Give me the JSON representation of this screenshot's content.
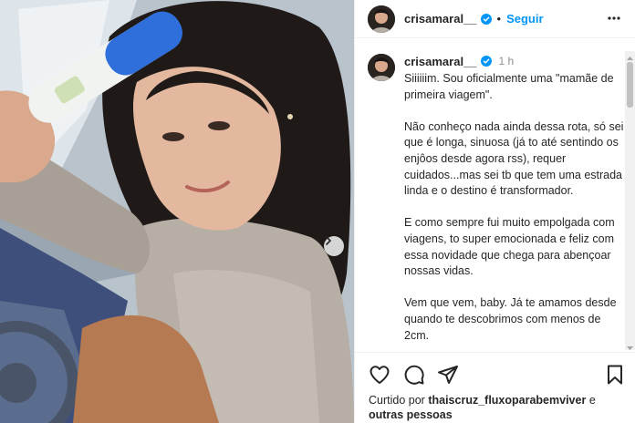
{
  "post": {
    "username": "crisamaral__",
    "follow_label": "Seguir",
    "separator": "•",
    "caption_time": "1 h",
    "caption_text": "Siiiiiim. Sou oficialmente uma \"mamãe de primeira viagem\".\n\nNão conheço nada ainda dessa rota, só sei que é longa, sinuosa (já to até sentindo os enjôos desde agora rss), requer cuidados...mas sei tb que tem uma estrada linda e o destino é transformador.\n\nE como sempre fui muito empolgada com viagens, to super emocionada e feliz com essa novidade que chega para abençoar nossas vidas.\n\nVem que vem, baby. Já te amamos desde quando te descobrimos com menos de 2cm."
  },
  "likes": {
    "prefix": "Curtido por",
    "user": "thaiscruz_fluxoparabemviver",
    "conj": "e",
    "others": "outras pessoas"
  },
  "icons": {
    "verified": "verified-badge-icon",
    "more": "more-options-icon",
    "like": "heart-icon",
    "comment": "comment-icon",
    "share": "share-icon",
    "save": "bookmark-icon",
    "next": "chevron-right-icon"
  },
  "colors": {
    "accent": "#0095f6",
    "text": "#262626",
    "muted": "#8e8e8e",
    "border": "#efefef"
  }
}
